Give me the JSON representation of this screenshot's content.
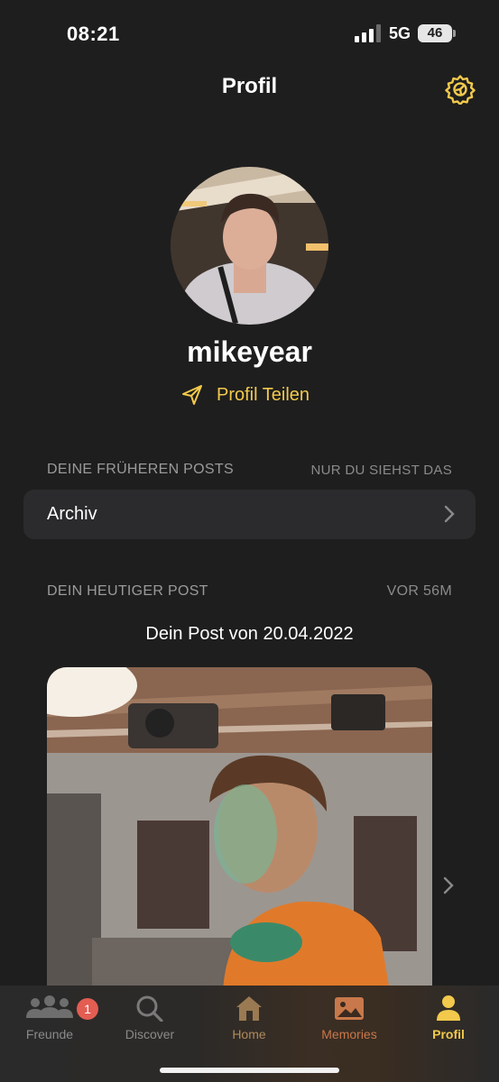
{
  "status": {
    "time": "08:21",
    "network": "5G",
    "battery": "46"
  },
  "header": {
    "title": "Profil"
  },
  "profile": {
    "username": "mikeyear",
    "share_label": "Profil Teilen"
  },
  "past_posts": {
    "label": "DEINE FRÜHEREN POSTS",
    "note": "NUR DU SIEHST DAS",
    "archive_label": "Archiv"
  },
  "today_post": {
    "label": "DEIN HEUTIGER POST",
    "note": "VOR 56M",
    "caption": "Dein Post von 20.04.2022"
  },
  "tabs": [
    {
      "label": "Freunde",
      "badge": "1",
      "icon": "friends-icon"
    },
    {
      "label": "Discover",
      "icon": "search-icon"
    },
    {
      "label": "Home",
      "icon": "home-icon"
    },
    {
      "label": "Memories",
      "icon": "memories-icon"
    },
    {
      "label": "Profil",
      "icon": "profile-icon",
      "active": true
    }
  ],
  "colors": {
    "accent": "#f2c94c",
    "background": "#1e1e1e",
    "card": "#2b2b2d",
    "badge": "#e35d52",
    "tab_memories": "#c8784a"
  }
}
